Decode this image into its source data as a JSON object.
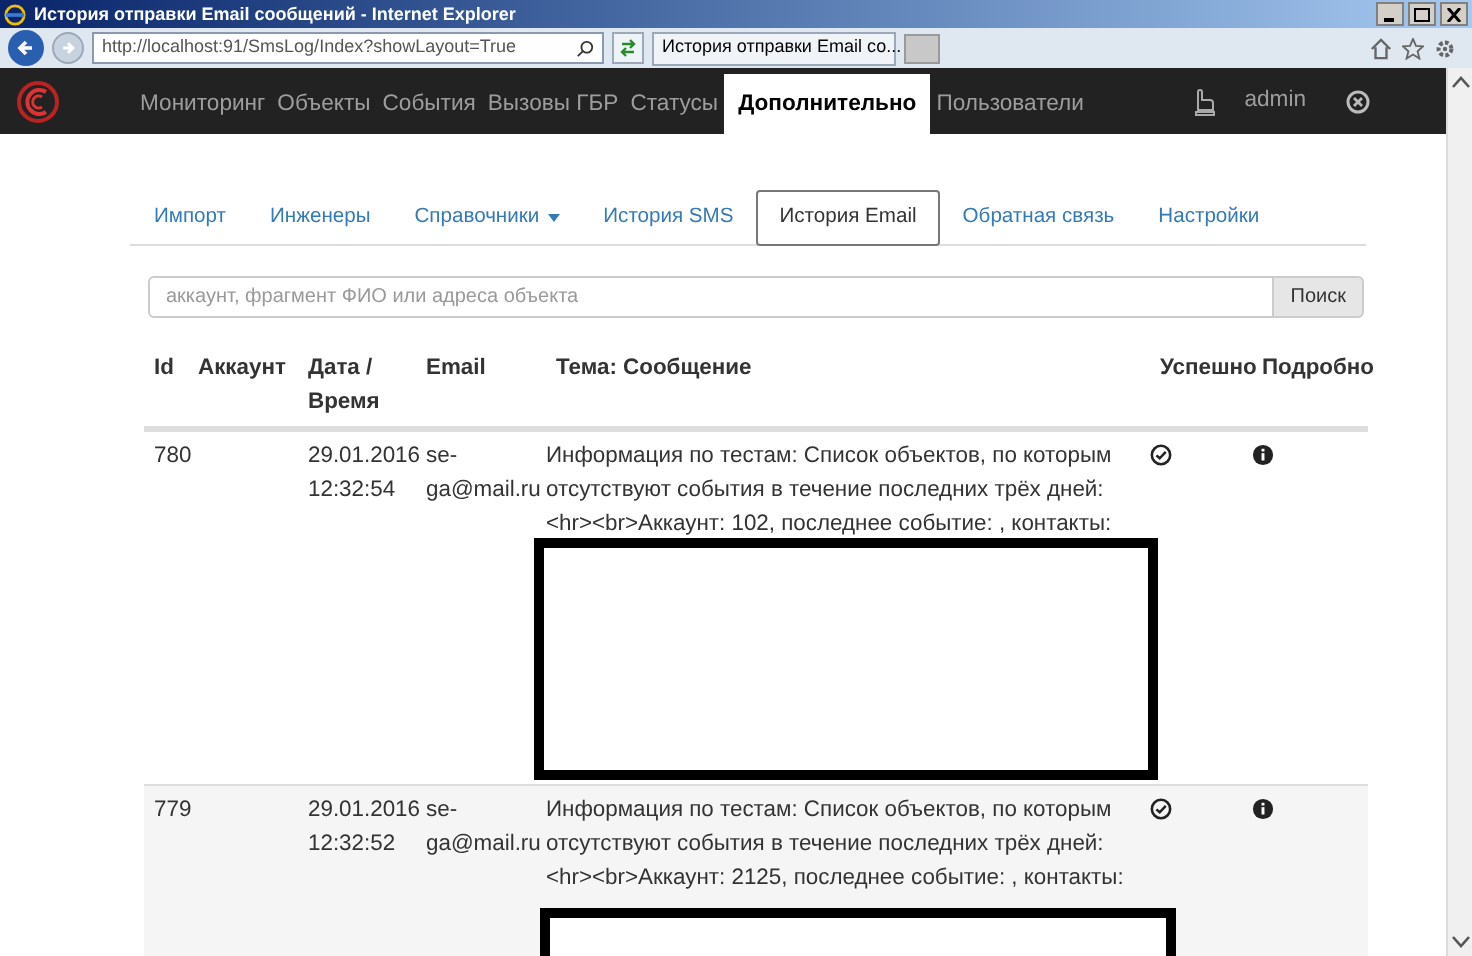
{
  "browser": {
    "title": "История отправки Email сообщений - Internet Explorer",
    "address": "http://localhost:91/SmsLog/Index?showLayout=True",
    "tab_title": "История отправки Email со..."
  },
  "navbar": {
    "items": [
      {
        "label": "Мониторинг",
        "selected": false
      },
      {
        "label": "Объекты",
        "selected": false
      },
      {
        "label": "События",
        "selected": false
      },
      {
        "label": "Вызовы ГБР",
        "selected": false
      },
      {
        "label": "Статусы",
        "selected": false
      },
      {
        "label": "Дополнительно",
        "selected": true
      },
      {
        "label": "Пользователи",
        "selected": false
      }
    ],
    "user": "admin"
  },
  "subnav": [
    {
      "label": "Импорт",
      "selected": false,
      "kind": "link"
    },
    {
      "label": "Инженеры",
      "selected": false,
      "kind": "link"
    },
    {
      "label": "Справочники",
      "selected": false,
      "kind": "dropdown"
    },
    {
      "label": "История SMS",
      "selected": false,
      "kind": "link"
    },
    {
      "label": "История Email",
      "selected": true,
      "kind": "link"
    },
    {
      "label": "Обратная связь",
      "selected": false,
      "kind": "link"
    },
    {
      "label": "Настройки",
      "selected": false,
      "kind": "link"
    }
  ],
  "search": {
    "placeholder": "аккаунт, фрагмент ФИО или адреса объекта",
    "button": "Поиск"
  },
  "table": {
    "columns": [
      "Id",
      "Аккаунт",
      "Дата / Время",
      "Email",
      "Тема: Сообщение",
      "Успешно",
      "Подробно"
    ],
    "rows": [
      {
        "id": "780",
        "datetime": "29.01.2016 12:32:54",
        "email": "se-ga@mail.ru",
        "message": "Информация по тестам: Список объектов, по которым отсутствуют события в течение последних трёх дней:<hr><br>Аккаунт: 102, последнее событие: , контакты:",
        "success": true
      },
      {
        "id": "779",
        "datetime": "29.01.2016 12:32:52",
        "email": "se-ga@mail.ru",
        "message": "Информация по тестам: Список объектов, по которым отсутствуют события в течение последних трёх дней:<hr><br>Аккаунт: 2125, последнее событие: , контакты:",
        "success": true
      }
    ]
  }
}
